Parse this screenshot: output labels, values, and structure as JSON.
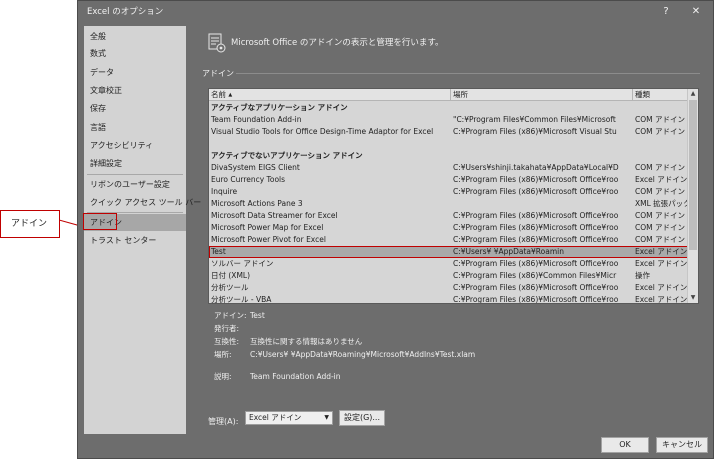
{
  "window": {
    "title": "Excel のオプション",
    "help_glyph": "?",
    "close_glyph": "✕"
  },
  "sidebar": {
    "items": [
      {
        "label": "全般"
      },
      {
        "label": "数式"
      },
      {
        "label": "データ"
      },
      {
        "label": "文章校正"
      },
      {
        "label": "保存"
      },
      {
        "label": "言語"
      },
      {
        "label": "アクセシビリティ"
      },
      {
        "label": "詳細設定"
      },
      {
        "label": "リボンのユーザー設定"
      },
      {
        "label": "クイック アクセス ツール バー"
      },
      {
        "label": "アドイン"
      },
      {
        "label": "トラスト センター"
      }
    ],
    "selected_index": 10
  },
  "content": {
    "header_icon": "addin-manager-icon",
    "header_text": "Microsoft Office のアドインの表示と管理を行います。",
    "section_label": "アドイン"
  },
  "addins_table": {
    "headers": {
      "name": "名前",
      "sort_glyph": "▲",
      "location": "場所",
      "type": "種類"
    },
    "rows": [
      {
        "group": "アクティブなアプリケーション アドイン"
      },
      {
        "name": "Team Foundation Add-in",
        "location": "\"C:¥Program Files¥Common Files¥Microsoft",
        "type": "COM アドイン"
      },
      {
        "name": "Visual Studio Tools for Office Design-Time Adaptor for Excel",
        "location": "C:¥Program Files (x86)¥Microsoft Visual Stu",
        "type": "COM アドイン"
      },
      {
        "name": "",
        "location": "",
        "type": ""
      },
      {
        "group": "アクティブでないアプリケーション アドイン"
      },
      {
        "name": "DivaSystem EIGS Client",
        "location": "C:¥Users¥shinji.takahata¥AppData¥Local¥D",
        "type": "COM アドイン"
      },
      {
        "name": "Euro Currency Tools",
        "location": "C:¥Program Files (x86)¥Microsoft Office¥roo",
        "type": "Excel アドイン"
      },
      {
        "name": "Inquire",
        "location": "C:¥Program Files (x86)¥Microsoft Office¥roo",
        "type": "COM アドイン"
      },
      {
        "name": "Microsoft Actions Pane 3",
        "location": "",
        "type": "XML 拡張パック"
      },
      {
        "name": "Microsoft Data Streamer for Excel",
        "location": "C:¥Program Files (x86)¥Microsoft Office¥roo",
        "type": "COM アドイン"
      },
      {
        "name": "Microsoft Power Map for Excel",
        "location": "C:¥Program Files (x86)¥Microsoft Office¥roo",
        "type": "COM アドイン"
      },
      {
        "name": "Microsoft Power Pivot for Excel",
        "location": "C:¥Program Files (x86)¥Microsoft Office¥roo",
        "type": "COM アドイン"
      },
      {
        "name": "Test",
        "location": "C:¥Users¥                ¥AppData¥Roamin",
        "type": "Excel アドイン",
        "selected": true
      },
      {
        "name": "ソルバー アドイン",
        "location": "C:¥Program Files (x86)¥Microsoft Office¥roo",
        "type": "Excel アドイン"
      },
      {
        "name": "日付 (XML)",
        "location": "C:¥Program Files (x86)¥Common Files¥Micr",
        "type": "操作"
      },
      {
        "name": "分析ツール",
        "location": "C:¥Program Files (x86)¥Microsoft Office¥roo",
        "type": "Excel アドイン"
      },
      {
        "name": "分析ツール - VBA",
        "location": "C:¥Program Files (x86)¥Microsoft Office¥roo",
        "type": "Excel アドイン"
      }
    ]
  },
  "details": {
    "addin_label": "アドイン:",
    "addin_value": "Test",
    "publisher_label": "発行者:",
    "publisher_value": "",
    "compat_label": "互換性:",
    "compat_value": "互換性に関する情報はありません",
    "location_label": "場所:",
    "location_value": "C:¥Users¥                    ¥AppData¥Roaming¥Microsoft¥AddIns¥Test.xlam",
    "description_label": "説明:",
    "description_value": "Team Foundation Add-in"
  },
  "manage": {
    "label": "管理(A):",
    "selected": "Excel アドイン",
    "go_button": "設定(G)..."
  },
  "footer": {
    "ok": "OK",
    "cancel": "キャンセル"
  },
  "callout": {
    "text": "アドイン"
  },
  "colors": {
    "dialog_bg": "#6d6d6d",
    "sidebar_bg": "#d3d3d3",
    "selection_outline": "#c00000"
  }
}
